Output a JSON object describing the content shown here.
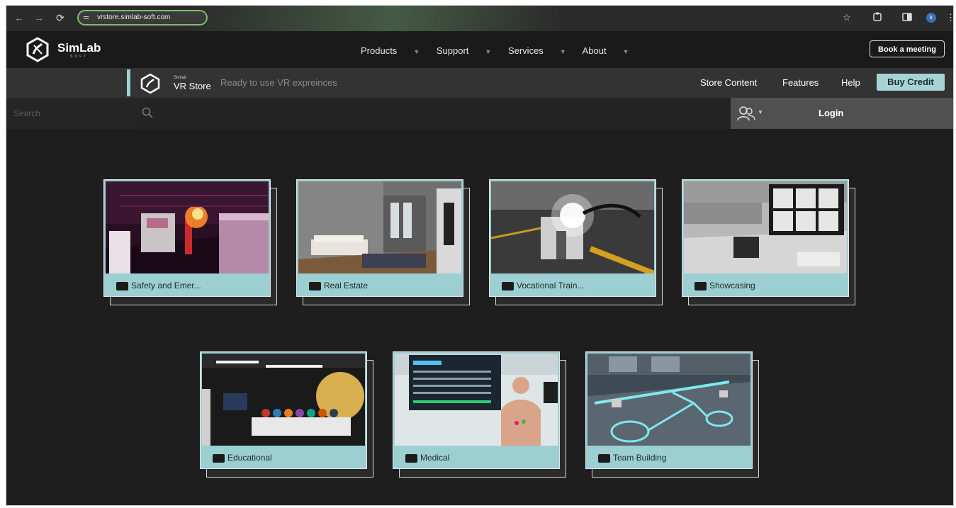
{
  "browser": {
    "url": "vrstore.simlab-soft.com",
    "avatar_initial": "k"
  },
  "site": {
    "brand": "SimLab",
    "brand_sub": "SOFT",
    "nav": [
      {
        "label": "Products"
      },
      {
        "label": "Support"
      },
      {
        "label": "Services"
      },
      {
        "label": "About"
      }
    ],
    "book_label": "Book a meeting"
  },
  "store": {
    "logo_small": "Simlab",
    "name": "VR Store",
    "tagline": "Ready to use VR expreinces",
    "links": [
      "Store Content",
      "Features",
      "Help"
    ],
    "buy_label": "Buy Credit"
  },
  "search": {
    "placeholder": "Search"
  },
  "login": {
    "label": "Login"
  },
  "categories": [
    {
      "label": "Safety and Emer..."
    },
    {
      "label": "Real Estate"
    },
    {
      "label": "Vocational Train..."
    },
    {
      "label": "Showcasing"
    },
    {
      "label": "Educational"
    },
    {
      "label": "Medical"
    },
    {
      "label": "Team Building"
    }
  ],
  "icons": {
    "back": "arrow-left-icon",
    "forward": "arrow-right-icon",
    "reload": "reload-icon",
    "site_settings": "tune-icon",
    "bookmark": "star-icon",
    "extensions": "puzzle-icon",
    "sidepanel": "sidepanel-icon",
    "menu": "kebab-icon",
    "search": "search-icon",
    "users": "users-icon",
    "camera": "camera-icon"
  }
}
